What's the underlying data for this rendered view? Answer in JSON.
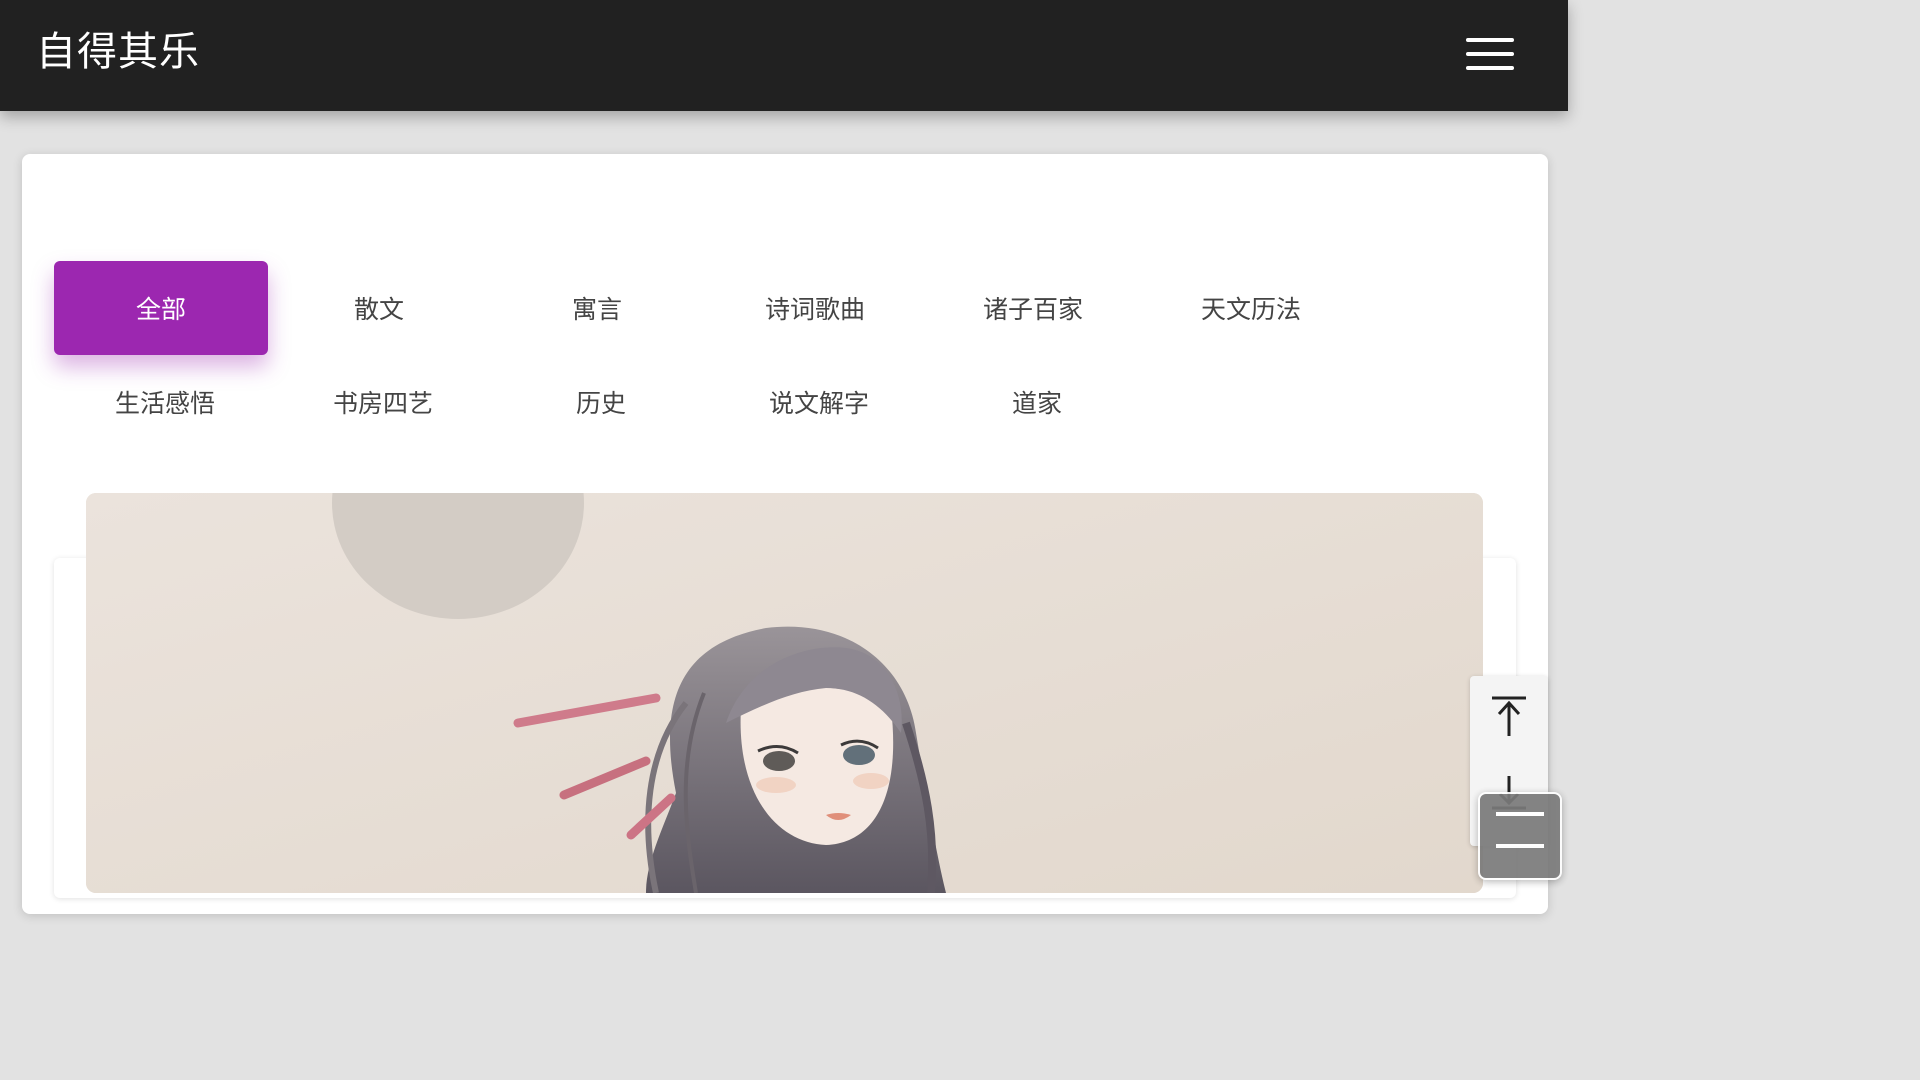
{
  "header": {
    "title": "自得其乐",
    "menu_icon": "hamburger-menu-icon"
  },
  "categories": [
    {
      "label": "全部",
      "active": true
    },
    {
      "label": "散文",
      "active": false
    },
    {
      "label": "寓言",
      "active": false
    },
    {
      "label": "诗词歌曲",
      "active": false
    },
    {
      "label": "诸子百家",
      "active": false
    },
    {
      "label": "天文历法",
      "active": false
    },
    {
      "label": "生活感悟",
      "active": false
    },
    {
      "label": "书房四艺",
      "active": false
    },
    {
      "label": "历史",
      "active": false
    },
    {
      "label": "说文解字",
      "active": false
    },
    {
      "label": "道家",
      "active": false
    }
  ],
  "colors": {
    "header_bg": "#212121",
    "accent": "#9c27b0",
    "page_bg": "#e2e2e2"
  },
  "side_tools": {
    "top_icon": "scroll-to-top-icon",
    "bottom_icon": "scroll-to-bottom-icon",
    "float_icon": "menu-lines-icon"
  }
}
